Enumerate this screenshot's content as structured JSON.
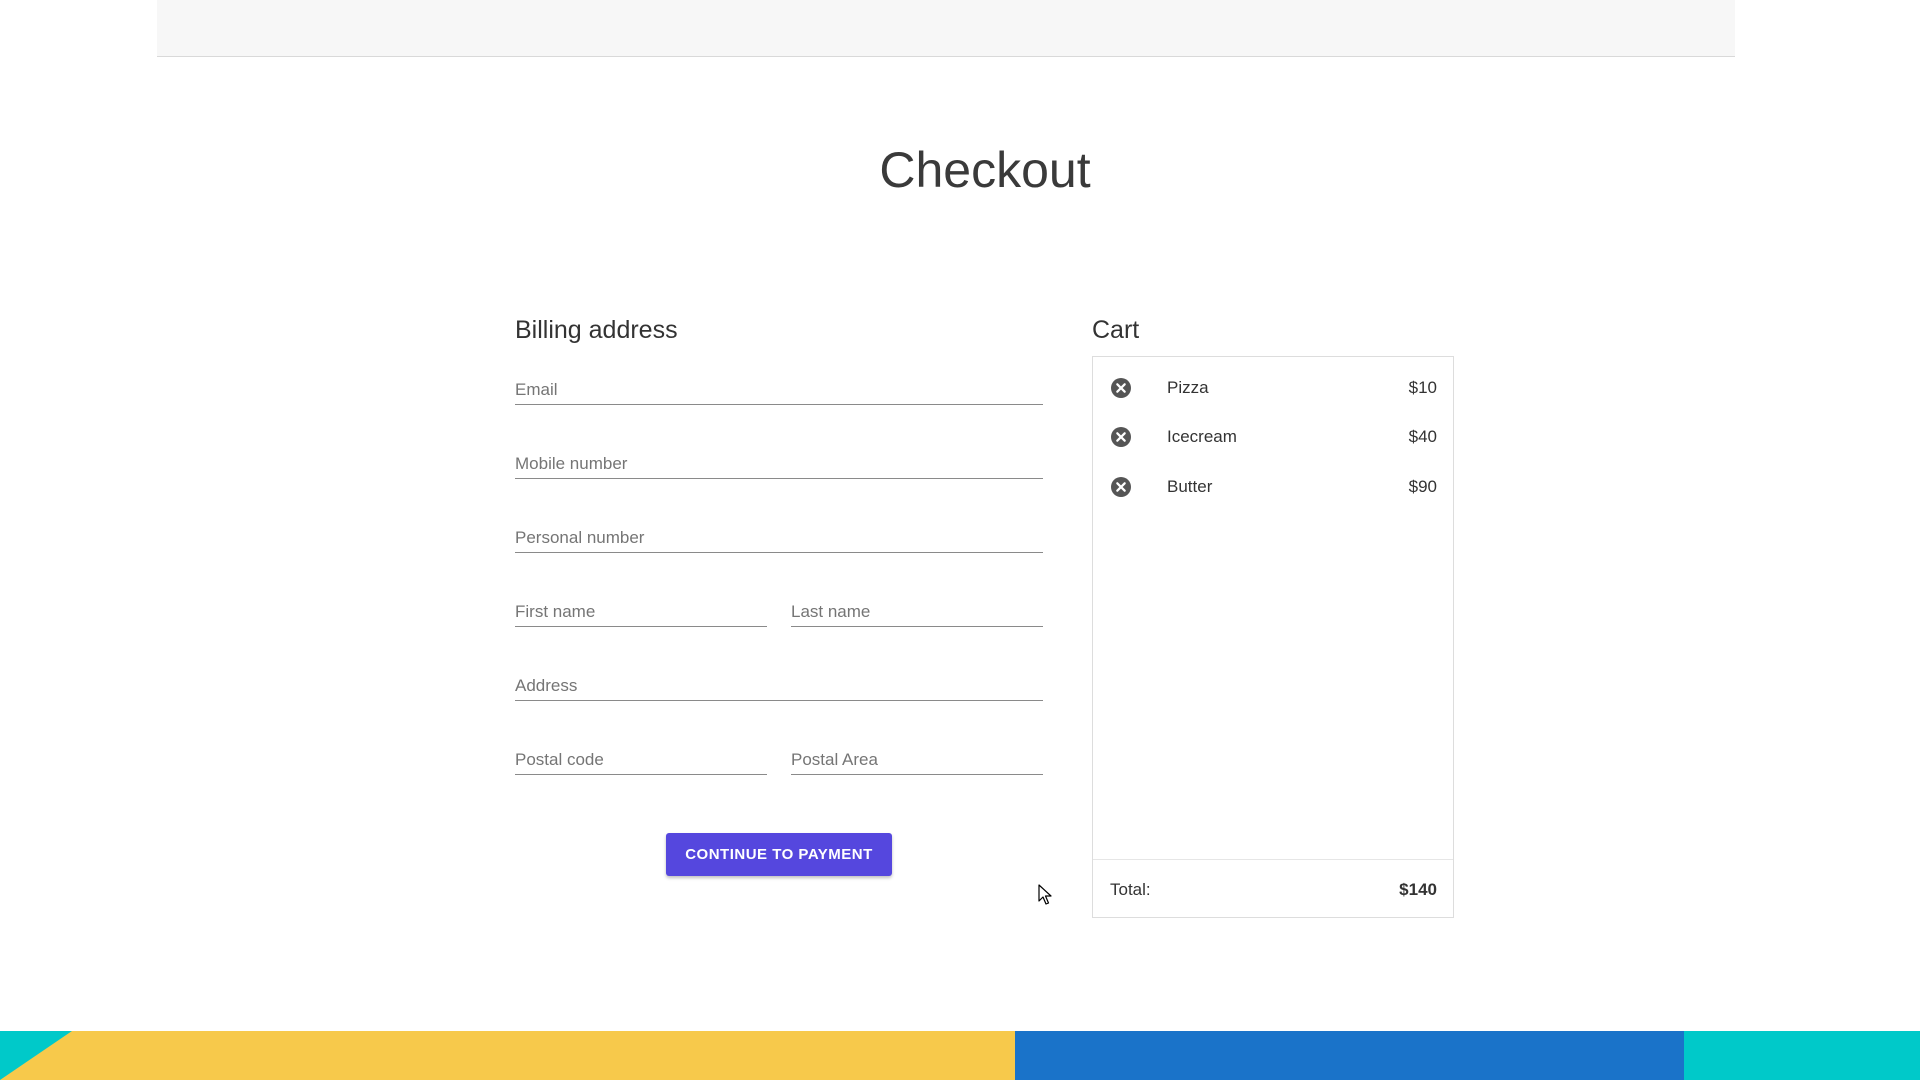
{
  "page": {
    "title": "Checkout"
  },
  "billing": {
    "heading": "Billing address",
    "fields": {
      "email": {
        "placeholder": "Email",
        "value": ""
      },
      "mobile": {
        "placeholder": "Mobile number",
        "value": ""
      },
      "personal_number": {
        "placeholder": "Personal number",
        "value": ""
      },
      "first_name": {
        "placeholder": "First name",
        "value": ""
      },
      "last_name": {
        "placeholder": "Last name",
        "value": ""
      },
      "address": {
        "placeholder": "Address",
        "value": ""
      },
      "postal_code": {
        "placeholder": "Postal code",
        "value": ""
      },
      "postal_area": {
        "placeholder": "Postal Area",
        "value": ""
      }
    },
    "continue_label": "CONTINUE TO PAYMENT"
  },
  "cart": {
    "heading": "Cart",
    "items": [
      {
        "name": "Pizza",
        "price": "$10",
        "remove_icon": "close-circle-icon"
      },
      {
        "name": "Icecream",
        "price": "$40",
        "remove_icon": "close-circle-icon"
      },
      {
        "name": "Butter",
        "price": "$90",
        "remove_icon": "close-circle-icon"
      }
    ],
    "total_label": "Total:",
    "total_value": "$140"
  },
  "colors": {
    "button": "#5547de",
    "footer_yellow": "#f7c94b",
    "footer_blue": "#1a73c9",
    "footer_teal": "#00c9c9",
    "remove_icon": "#555555"
  }
}
